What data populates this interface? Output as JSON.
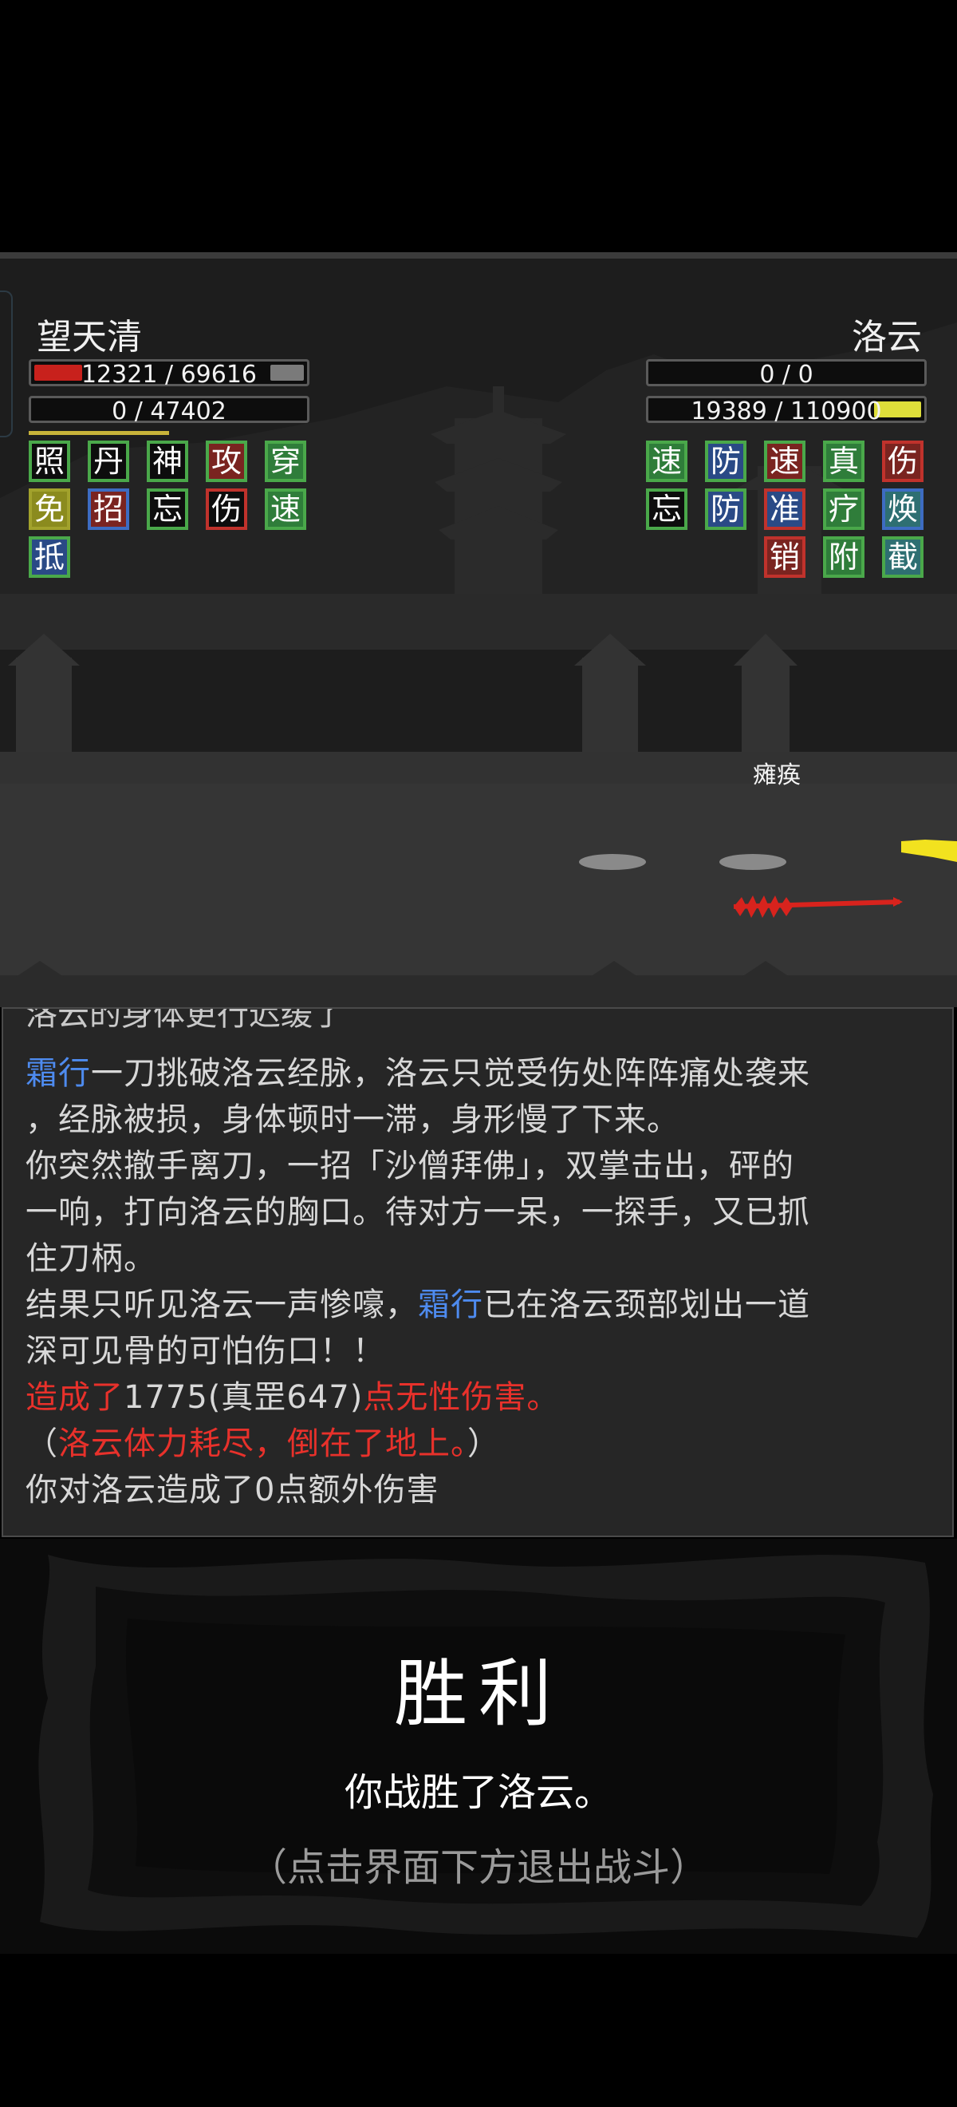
{
  "player": {
    "name": "望天清",
    "hp_text": "12321 / 69616",
    "hp_fraction": 0.177,
    "mp_text": "0 / 47402",
    "buffs": [
      "照",
      "丹",
      "神",
      "攻",
      "穿",
      "免",
      "招",
      "忘",
      "伤",
      "速",
      "抵"
    ]
  },
  "enemy": {
    "name": "洛云",
    "hp_text": "0 / 0",
    "mp_text": "19389 / 110900",
    "mp_fraction": 0.175,
    "buffs": [
      "速",
      "防",
      "速",
      "真",
      "伤",
      "忘",
      "防",
      "准",
      "疗",
      "焕",
      "销",
      "附",
      "截"
    ],
    "status": "瘫痪"
  },
  "log": {
    "cut_line": "洛云的身体更行迟缓了",
    "l1_name": "霜行",
    "l1_rest": "一刀挑破洛云经脉，洛云只觉受伤处阵阵痛处袭来",
    "l2": "，经脉被损，身体顿时一滞，身形慢了下来。",
    "l3": "你突然撤手离刀，一招「沙僧拜佛」，双掌击出，砰的",
    "l4": "一响，打向洛云的胸口。待对方一呆，一探手，又已抓",
    "l5": "住刀柄。",
    "l6_a": "结果只听见洛云一声惨嚎，",
    "l6_name": "霜行",
    "l6_b": "已在洛云颈部划出一道",
    "l7": "深可见骨的可怕伤口！！",
    "l8_a": "造成了",
    "l8_b": "1775(真罡647)",
    "l8_c": "点无性伤害。",
    "l9_a": "（",
    "l9_b": "洛云体力耗尽，倒在了地上。",
    "l9_c": "）",
    "l10": "你对洛云造成了0点额外伤害"
  },
  "victory": {
    "title": "胜利",
    "subtitle": "你战胜了洛云。",
    "hint": "（点击界面下方退出战斗）"
  },
  "colors": {
    "hp_red": "#c8211c",
    "mp_yellow": "#dede3a",
    "link_blue": "#4e8bef",
    "damage_red": "#e8312b"
  }
}
